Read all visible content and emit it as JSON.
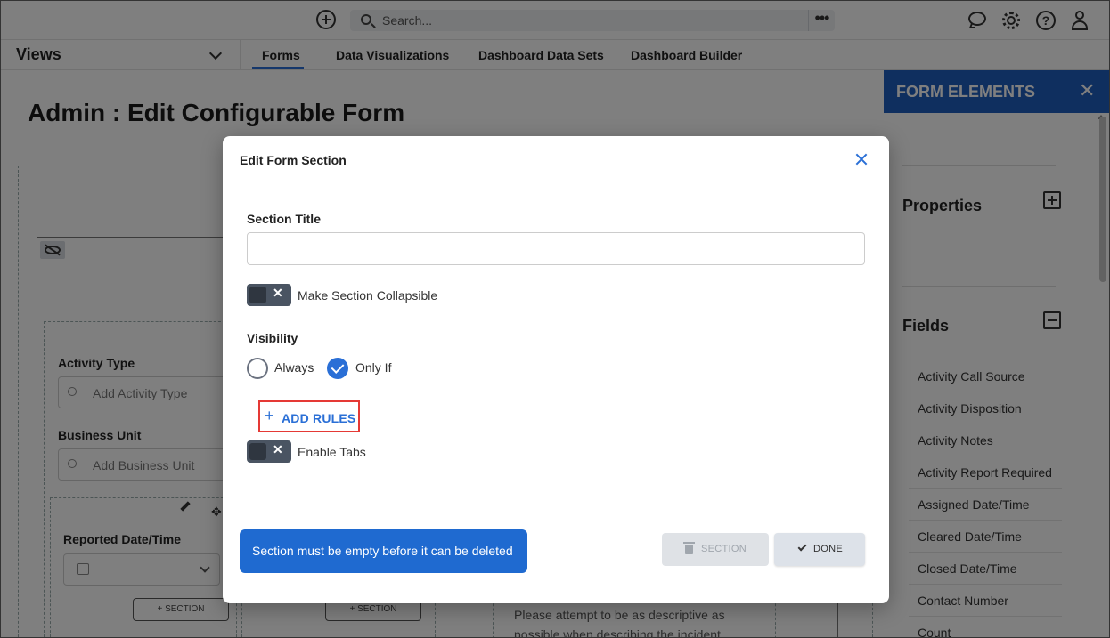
{
  "topbar": {
    "search_placeholder": "Search...",
    "more_label": "•••"
  },
  "nav": {
    "views_label": "Views",
    "tabs": [
      {
        "label": "Forms",
        "active": true
      },
      {
        "label": "Data Visualizations",
        "active": false
      },
      {
        "label": "Dashboard Data Sets",
        "active": false
      },
      {
        "label": "Dashboard Builder",
        "active": false
      }
    ]
  },
  "page": {
    "title": "Admin : Edit Configurable Form",
    "fields": [
      {
        "label": "Activity Type",
        "placeholder": "Add Activity Type"
      },
      {
        "label": "Business Unit",
        "placeholder": "Add Business Unit"
      },
      {
        "label": "Reported Date/Time"
      }
    ],
    "section_button_label": "SECTION",
    "description_text_1": "Please attempt to be as descriptive as",
    "description_text_2": "possible when describing the incident"
  },
  "right_panel": {
    "title": "FORM ELEMENTS",
    "properties_label": "Properties",
    "fields_label": "Fields",
    "field_items": [
      "Activity Call Source",
      "Activity Disposition",
      "Activity Notes",
      "Activity Report Required",
      "Assigned Date/Time",
      "Cleared Date/Time",
      "Closed Date/Time",
      "Contact Number",
      "Count"
    ]
  },
  "modal": {
    "title": "Edit Form Section",
    "section_title_label": "Section Title",
    "section_title_value": "",
    "collapsible_label": "Make Section Collapsible",
    "visibility_label": "Visibility",
    "visibility_options": [
      {
        "label": "Always",
        "selected": false
      },
      {
        "label": "Only If",
        "selected": true
      }
    ],
    "add_rules_label": "ADD RULES",
    "enable_tabs_label": "Enable Tabs",
    "info_message": "Section must be empty before it can be deleted",
    "delete_section_label": "SECTION",
    "done_label": "DONE"
  },
  "colors": {
    "accent": "#2a6fd6",
    "panel_header": "#1f5fbf",
    "highlight_border": "#e53935",
    "toggle_off": "#4a5462"
  }
}
